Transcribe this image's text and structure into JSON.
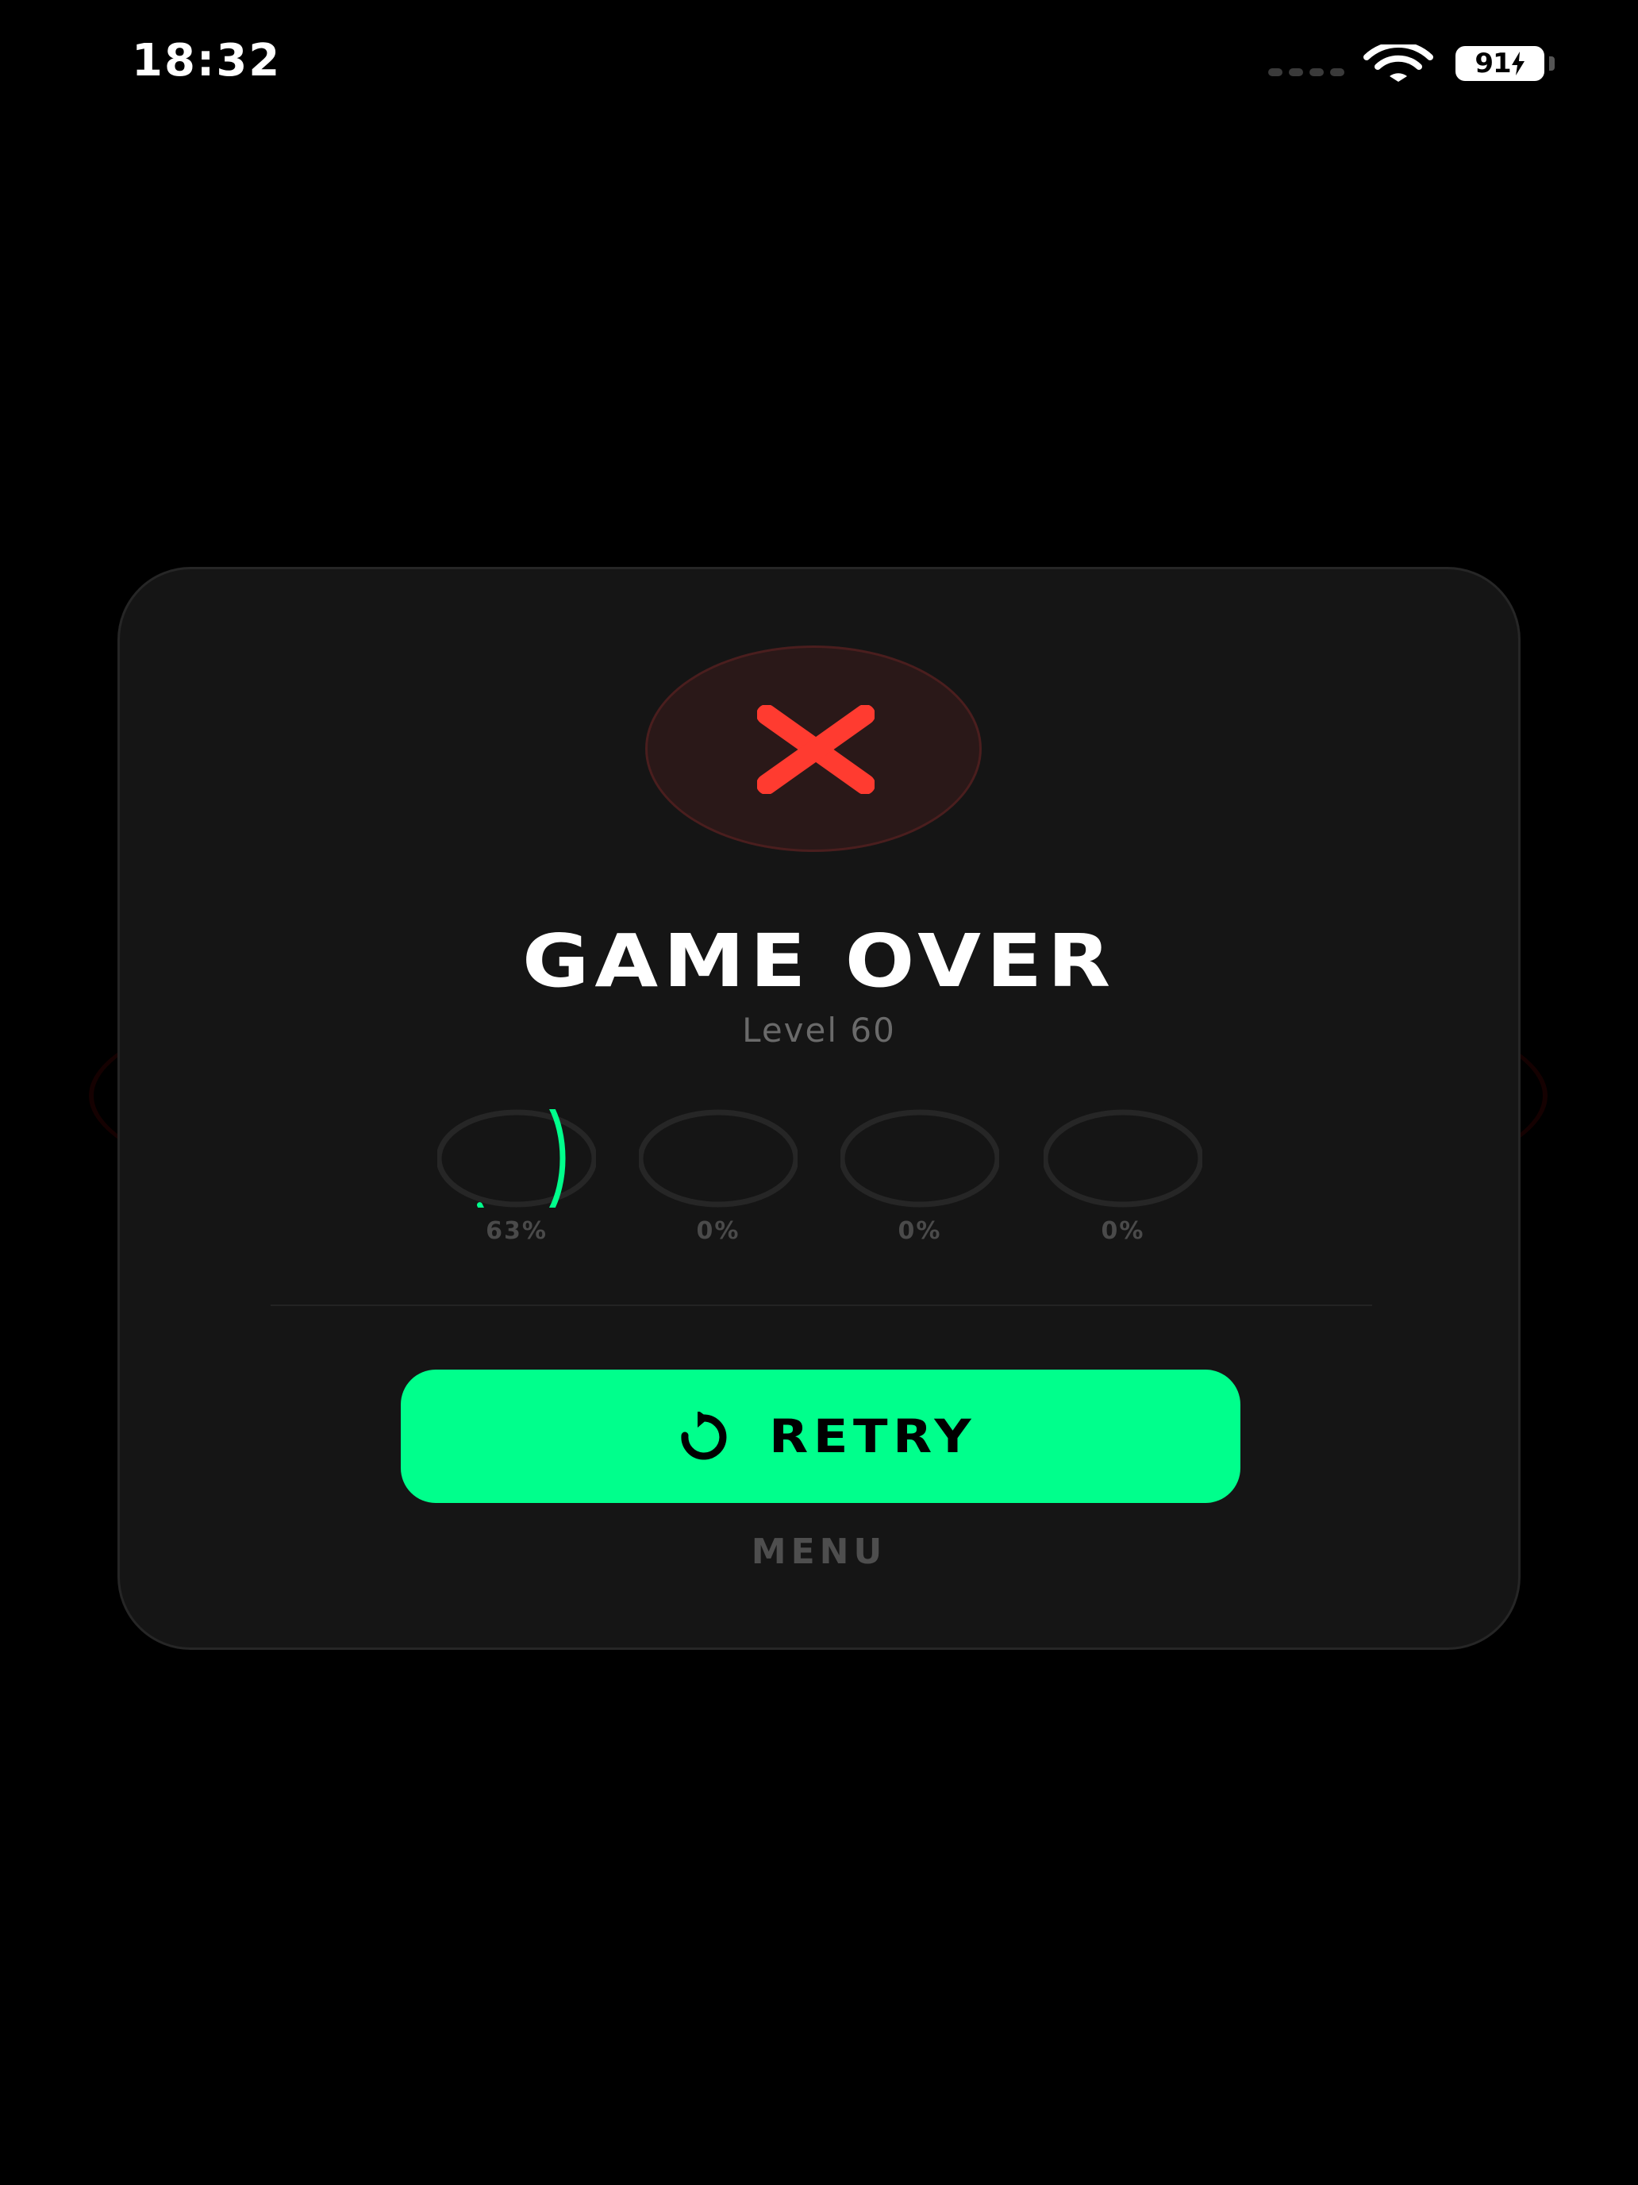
{
  "status_bar": {
    "time": "18:32",
    "battery": "91"
  },
  "dialog": {
    "title": "GAME OVER",
    "level": "Level 60",
    "progress": [
      {
        "value": 63,
        "label": "63%"
      },
      {
        "value": 0,
        "label": "0%"
      },
      {
        "value": 0,
        "label": "0%"
      },
      {
        "value": 0,
        "label": "0%"
      }
    ],
    "retry_label": "RETRY",
    "menu_label": "MENU"
  },
  "colors": {
    "accent": "#00ff8c",
    "danger": "#ff3b30",
    "card": "#151515"
  },
  "icons": {
    "status": [
      "signal-icon",
      "wifi-icon",
      "battery-icon"
    ],
    "badge": "close-icon",
    "retry": "retry-icon"
  }
}
